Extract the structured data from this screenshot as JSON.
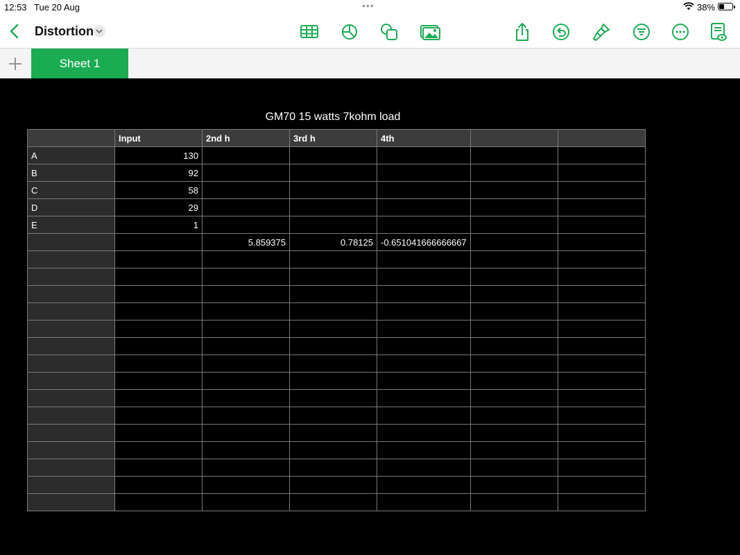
{
  "status": {
    "time": "12:53",
    "date": "Tue 20 Aug",
    "battery_percent": "38%",
    "battery_level": 0.38
  },
  "toolbar": {
    "document_title": "Distortion",
    "icons": [
      "table-icon",
      "chart-icon",
      "shape-icon",
      "media-icon",
      "share-icon",
      "undo-icon",
      "format-brush-icon",
      "organize-icon",
      "more-icon",
      "reading-view-icon"
    ],
    "accent_color": "#1aab53"
  },
  "tabs": {
    "add_label": "+",
    "sheets": [
      "Sheet 1"
    ]
  },
  "table": {
    "title": "GM70 15 watts 7kohm load",
    "columns": [
      "",
      "Input",
      "2nd h",
      "3rd h",
      "4th",
      "",
      ""
    ],
    "rows": [
      [
        "A",
        "130",
        "",
        "",
        "",
        "",
        ""
      ],
      [
        "B",
        "92",
        "",
        "",
        "",
        "",
        ""
      ],
      [
        "C",
        "58",
        "",
        "",
        "",
        "",
        ""
      ],
      [
        "D",
        "29",
        "",
        "",
        "",
        "",
        ""
      ],
      [
        "E",
        "1",
        "",
        "",
        "",
        "",
        ""
      ],
      [
        "",
        "",
        "5.859375",
        "0.78125",
        "-0.651041666666667",
        "",
        ""
      ],
      [
        "",
        "",
        "",
        "",
        "",
        "",
        ""
      ],
      [
        "",
        "",
        "",
        "",
        "",
        "",
        ""
      ],
      [
        "",
        "",
        "",
        "",
        "",
        "",
        ""
      ],
      [
        "",
        "",
        "",
        "",
        "",
        "",
        ""
      ],
      [
        "",
        "",
        "",
        "",
        "",
        "",
        ""
      ],
      [
        "",
        "",
        "",
        "",
        "",
        "",
        ""
      ],
      [
        "",
        "",
        "",
        "",
        "",
        "",
        ""
      ],
      [
        "",
        "",
        "",
        "",
        "",
        "",
        ""
      ],
      [
        "",
        "",
        "",
        "",
        "",
        "",
        ""
      ],
      [
        "",
        "",
        "",
        "",
        "",
        "",
        ""
      ],
      [
        "",
        "",
        "",
        "",
        "",
        "",
        ""
      ],
      [
        "",
        "",
        "",
        "",
        "",
        "",
        ""
      ],
      [
        "",
        "",
        "",
        "",
        "",
        "",
        ""
      ],
      [
        "",
        "",
        "",
        "",
        "",
        "",
        ""
      ],
      [
        "",
        "",
        "",
        "",
        "",
        "",
        ""
      ]
    ]
  }
}
